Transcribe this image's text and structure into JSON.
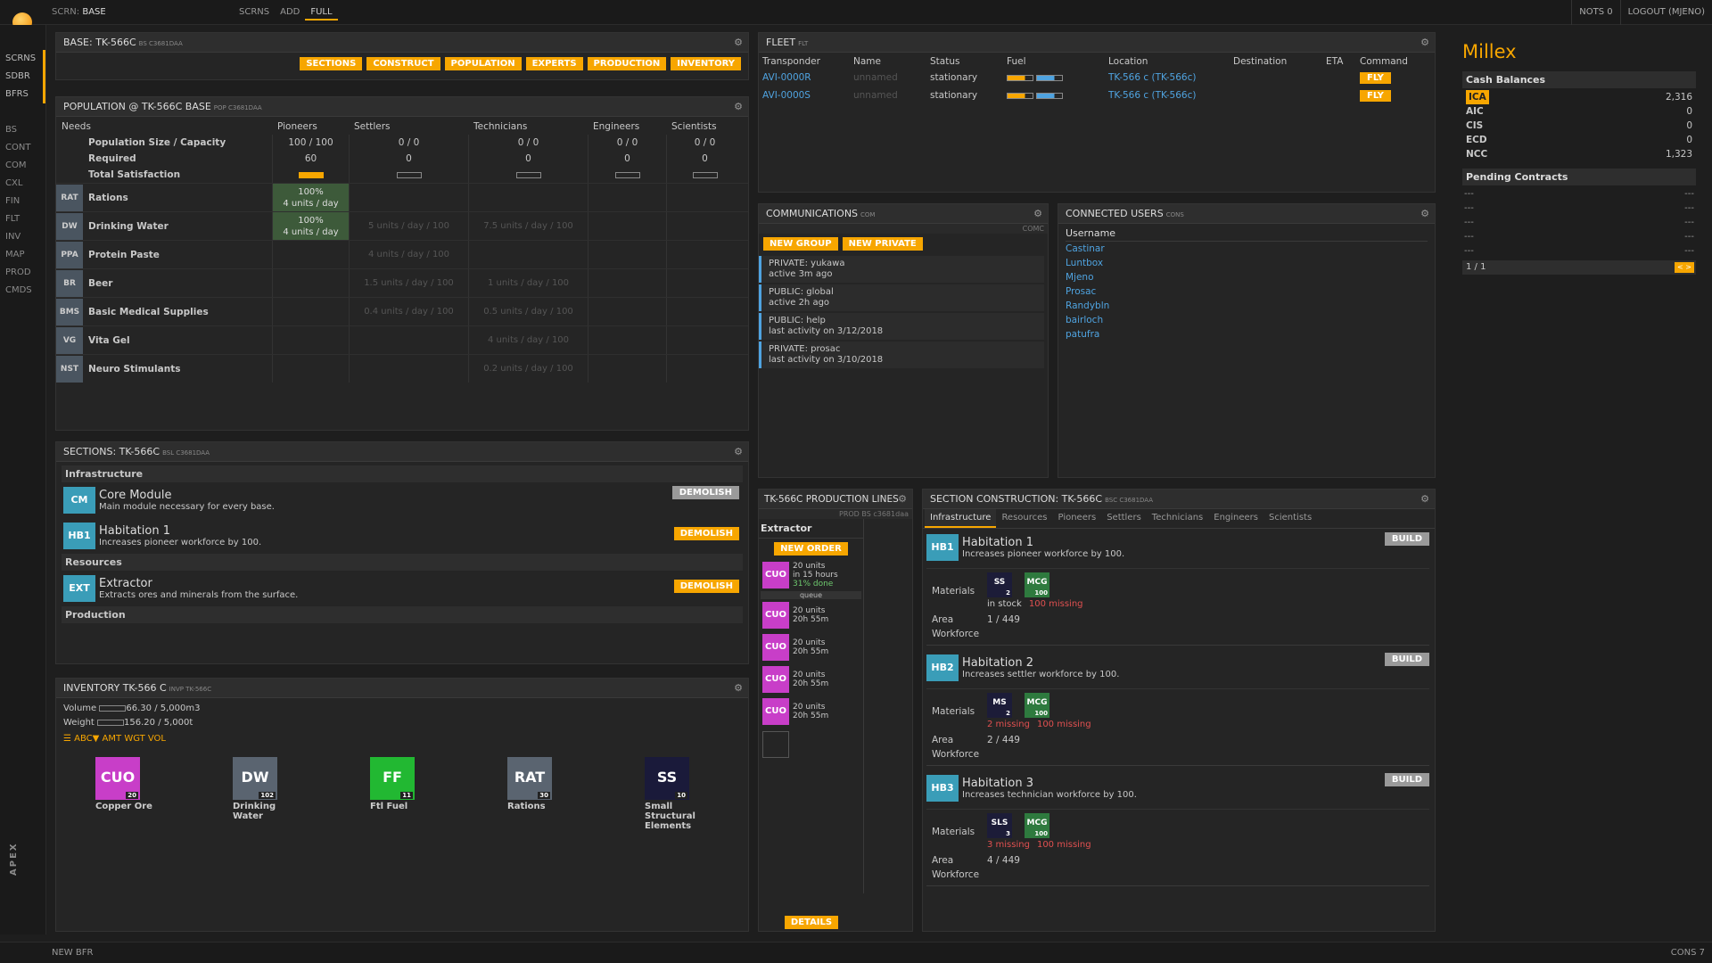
{
  "topbar": {
    "screen_label": "SCRN:",
    "screen_name": "BASE",
    "buttons": [
      "SCRNS",
      "ADD",
      "FULL"
    ],
    "nots": "NOTS 0",
    "logout": "LOGOUT (MJENO)"
  },
  "leftnav": {
    "top": [
      "SCRNS",
      "SDBR",
      "BFRS"
    ],
    "main": [
      "BS",
      "CONT",
      "COM",
      "CXL",
      "FIN",
      "FLT",
      "INV",
      "MAP",
      "PROD",
      "CMDS"
    ],
    "brand": "APEX"
  },
  "bottombar": {
    "left": "NEW BFR",
    "right": "CONS 7"
  },
  "base": {
    "title": "BASE: TK-566C",
    "code": "BS C3681DAA",
    "buttons": [
      "SECTIONS",
      "CONSTRUCT",
      "POPULATION",
      "EXPERTS",
      "PRODUCTION",
      "INVENTORY"
    ]
  },
  "population": {
    "title": "POPULATION @ TK-566C BASE",
    "code": "POP C3681DAA",
    "cols": [
      "Needs",
      "Pioneers",
      "Settlers",
      "Technicians",
      "Engineers",
      "Scientists"
    ],
    "rows": [
      {
        "label": "Population Size / Capacity",
        "vals": [
          "100 / 100",
          "0 / 0",
          "0 / 0",
          "0 / 0",
          "0 / 0"
        ]
      },
      {
        "label": "Required",
        "vals": [
          "60",
          "0",
          "0",
          "0",
          "0"
        ]
      },
      {
        "label": "Total Satisfaction",
        "vals": [
          "",
          "",
          "",
          "",
          ""
        ]
      }
    ],
    "satisfaction": [
      1,
      0,
      0,
      0,
      0
    ],
    "needs": [
      {
        "tick": "RAT",
        "name": "Rations",
        "vals": [
          "100%|4 units / day",
          "",
          "",
          "",
          ""
        ]
      },
      {
        "tick": "DW",
        "name": "Drinking Water",
        "vals": [
          "100%|4 units / day",
          "5 units / day / 100",
          "7.5 units / day / 100",
          "",
          ""
        ]
      },
      {
        "tick": "PPA",
        "name": "Protein Paste",
        "vals": [
          "",
          "4 units / day / 100",
          "",
          "",
          ""
        ]
      },
      {
        "tick": "BR",
        "name": "Beer",
        "vals": [
          "",
          "1.5 units / day / 100",
          "1 units / day / 100",
          "",
          ""
        ]
      },
      {
        "tick": "BMS",
        "name": "Basic Medical Supplies",
        "vals": [
          "",
          "0.4 units / day / 100",
          "0.5 units / day / 100",
          "",
          ""
        ]
      },
      {
        "tick": "VG",
        "name": "Vita Gel",
        "vals": [
          "",
          "",
          "4 units / day / 100",
          "",
          ""
        ]
      },
      {
        "tick": "NST",
        "name": "Neuro Stimulants",
        "vals": [
          "",
          "",
          "0.2 units / day / 100",
          "",
          ""
        ]
      }
    ]
  },
  "sections": {
    "title": "SECTIONS: TK-566C",
    "code": "BSL C3681DAA",
    "groups": [
      "Infrastructure",
      "Resources",
      "Production"
    ],
    "items": [
      {
        "tag": "CM",
        "name": "Core Module",
        "desc": "Main module necessary for every base.",
        "btn": "DEMOLISH",
        "color": "#3a9db8"
      },
      {
        "tag": "HB1",
        "name": "Habitation 1",
        "desc": "Increases pioneer workforce by 100.",
        "btn": "DEMOLISH",
        "color": "#3a9db8"
      },
      {
        "tag": "EXT",
        "name": "Extractor",
        "desc": "Extracts ores and minerals from the surface.",
        "btn": "DEMOLISH",
        "color": "#3a9db8"
      }
    ]
  },
  "inventory": {
    "title": "INVENTORY TK-566 C",
    "code": "INVP TK-566C",
    "volume_label": "Volume",
    "volume": "66.30 / 5,000m3",
    "weight_label": "Weight",
    "weight": "156.20 / 5,000t",
    "sort": [
      "ABC▼",
      "AMT",
      "WGT",
      "VOL"
    ],
    "items": [
      {
        "tick": "CUO",
        "qty": "20",
        "name": "Copper Ore",
        "color": "#c83ec8"
      },
      {
        "tick": "DW",
        "qty": "102",
        "name": "Drinking Water",
        "color": "#5a6470"
      },
      {
        "tick": "FF",
        "qty": "11",
        "name": "Ftl Fuel",
        "color": "#22b832"
      },
      {
        "tick": "RAT",
        "qty": "30",
        "name": "Rations",
        "color": "#5a6470"
      },
      {
        "tick": "SS",
        "qty": "10",
        "name": "Small Structural Elements",
        "color": "#1a1a3a"
      }
    ]
  },
  "fleet": {
    "title": "FLEET",
    "code": "FLT",
    "cols": [
      "Transponder",
      "Name",
      "Status",
      "Fuel",
      "Location",
      "Destination",
      "ETA",
      "Command"
    ],
    "rows": [
      {
        "transponder": "AVI-0000R",
        "name": "unnamed",
        "status": "stationary",
        "location": "TK-566 c (TK-566c)",
        "command": "FLY"
      },
      {
        "transponder": "AVI-0000S",
        "name": "unnamed",
        "status": "stationary",
        "location": "TK-566 c (TK-566c)",
        "command": "FLY"
      }
    ]
  },
  "comms": {
    "title": "COMMUNICATIONS",
    "code": "COM",
    "tag": "COMC",
    "buttons": [
      "NEW GROUP",
      "NEW PRIVATE"
    ],
    "items": [
      {
        "a": "PRIVATE: yukawa",
        "b": "active 3m ago"
      },
      {
        "a": "PUBLIC: global",
        "b": "active 2h ago"
      },
      {
        "a": "PUBLIC: help",
        "b": "last activity on 3/12/2018"
      },
      {
        "a": "PRIVATE: prosac",
        "b": "last activity on 3/10/2018"
      }
    ]
  },
  "users": {
    "title": "CONNECTED USERS",
    "code": "CONS",
    "header": "Username",
    "list": [
      "Castinar",
      "Luntbox",
      "Mjeno",
      "Prosac",
      "Randybln",
      "bairloch",
      "patufra"
    ]
  },
  "prodlines": {
    "title": "TK-566C PRODUCTION LINES",
    "code": "PROD BS c3681daa",
    "line": "Extractor",
    "new_order": "NEW ORDER",
    "orders": [
      {
        "tick": "CUO",
        "a": "20 units",
        "b": "in 15 hours",
        "c": "31% done"
      },
      {
        "tick": "CUO",
        "a": "20 units",
        "b": "20h 55m",
        "c": ""
      },
      {
        "tick": "CUO",
        "a": "20 units",
        "b": "20h 55m",
        "c": ""
      },
      {
        "tick": "CUO",
        "a": "20 units",
        "b": "20h 55m",
        "c": ""
      },
      {
        "tick": "CUO",
        "a": "20 units",
        "b": "20h 55m",
        "c": ""
      }
    ],
    "queue": "queue",
    "details": "DETAILS"
  },
  "construction": {
    "title": "SECTION CONSTRUCTION: TK-566C",
    "code": "BSC C3681DAA",
    "tabs": [
      "Infrastructure",
      "Resources",
      "Pioneers",
      "Settlers",
      "Technicians",
      "Engineers",
      "Scientists"
    ],
    "items": [
      {
        "tag": "HB1",
        "name": "Habitation 1",
        "desc": "Increases pioneer workforce by 100.",
        "mats": [
          {
            "t": "SS",
            "q": "2"
          },
          {
            "t": "MCG",
            "q": "100"
          }
        ],
        "stock": "in stock",
        "missing": "100 missing",
        "area": "1 / 449",
        "build": "BUILD"
      },
      {
        "tag": "HB2",
        "name": "Habitation 2",
        "desc": "Increases settler workforce by 100.",
        "mats": [
          {
            "t": "MS",
            "q": "2"
          },
          {
            "t": "MCG",
            "q": "100"
          }
        ],
        "stock": "2 missing",
        "missing": "100 missing",
        "area": "2 / 449",
        "build": "BUILD"
      },
      {
        "tag": "HB3",
        "name": "Habitation 3",
        "desc": "Increases technician workforce by 100.",
        "mats": [
          {
            "t": "SLS",
            "q": "3"
          },
          {
            "t": "MCG",
            "q": "100"
          }
        ],
        "stock": "3 missing",
        "missing": "100 missing",
        "area": "4 / 449",
        "build": "BUILD"
      }
    ],
    "labels": {
      "materials": "Materials",
      "area": "Area",
      "workforce": "Workforce"
    }
  },
  "sidebar": {
    "company": "Millex",
    "cash_title": "Cash Balances",
    "cash": [
      {
        "cur": "ICA",
        "val": "2,316"
      },
      {
        "cur": "AIC",
        "val": "0"
      },
      {
        "cur": "CIS",
        "val": "0"
      },
      {
        "cur": "ECD",
        "val": "0"
      },
      {
        "cur": "NCC",
        "val": "1,323"
      }
    ],
    "pending_title": "Pending Contracts",
    "pending": [
      "---",
      "---",
      "---",
      "---",
      "---"
    ],
    "page": "1 / 1"
  },
  "colors": {
    "accent": "#f7a600",
    "link": "#4fa3e0",
    "danger": "#e05050",
    "sat_fill": "#f7a600"
  }
}
